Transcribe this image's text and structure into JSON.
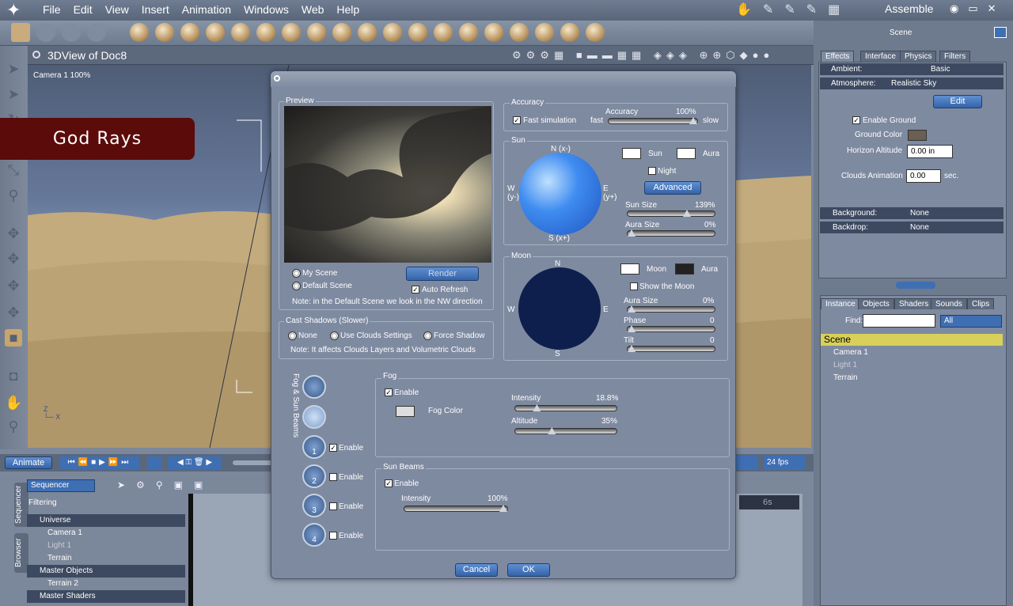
{
  "menu": [
    "File",
    "Edit",
    "View",
    "Insert",
    "Animation",
    "Windows",
    "Web",
    "Help"
  ],
  "topright": {
    "room": "Assemble"
  },
  "view": {
    "title": "3DView of Doc8",
    "camera": "Camera 1 100%",
    "banner": "God Rays"
  },
  "timeline": {
    "animate": "Animate",
    "fps": "24 fps",
    "sequencer": "Sequencer",
    "filtering": "Filtering",
    "time_label": "6s",
    "tabs": [
      "Sequencer",
      "Browser"
    ],
    "rows": [
      "Universe",
      "Camera 1",
      "Light 1",
      "Terrain",
      "Master Objects",
      "Terrain 2",
      "Master Shaders"
    ]
  },
  "panel": {
    "title": "Scene",
    "tabs": [
      "Effects",
      "Interface",
      "Physics",
      "Filters"
    ],
    "ambient_label": "Ambient:",
    "ambient_value": "Basic",
    "atmosphere_label": "Atmosphere:",
    "atmosphere_value": "Realistic Sky",
    "edit": "Edit",
    "enable_ground": "Enable Ground",
    "ground_color": "Ground Color",
    "horizon_altitude": "Horizon Altitude",
    "horizon_value": "0.00 in",
    "clouds_animation": "Clouds Animation",
    "clouds_value": "0.00",
    "clouds_unit": "sec.",
    "background_label": "Background:",
    "background_value": "None",
    "backdrop_label": "Backdrop:",
    "backdrop_value": "None",
    "tabs2": [
      "Instance",
      "Objects",
      "Shaders",
      "Sounds",
      "Clips"
    ],
    "find_label": "Find:",
    "find_value": "",
    "filter": "All",
    "tree": [
      "Scene",
      "Camera 1",
      "Light 1",
      "Terrain"
    ]
  },
  "dialog": {
    "preview": "Preview",
    "my_scene": "My Scene",
    "default_scene": "Default Scene",
    "render": "Render",
    "auto_refresh": "Auto Refresh",
    "note1": "Note: in the Default Scene we look in the NW direction",
    "cast_shadows": "Cast Shadows (Slower)",
    "none": "None",
    "use_clouds": "Use Clouds Settings",
    "force_shadow": "Force Shadow",
    "note2": "Note: It affects Clouds Layers and Volumetric Clouds",
    "accuracy_group": "Accuracy",
    "fast_sim": "Fast simulation",
    "fast": "fast",
    "slow": "slow",
    "accuracy_label": "Accuracy",
    "accuracy_value": "100%",
    "accuracy_level": 1.0,
    "sun_group": "Sun",
    "sun_n": "N (x-)",
    "sun_s": "S (x+)",
    "sun_w": "W\n(y-)",
    "sun_e": "E\n(y+)",
    "sun": "Sun",
    "aura": "Aura",
    "night": "Night",
    "advanced": "Advanced",
    "sun_size": "Sun Size",
    "sun_size_value": "139%",
    "sun_size_level": 0.7,
    "aura_size": "Aura Size",
    "aura_size_value": "0%",
    "aura_size_level": 0.0,
    "moon_group": "Moon",
    "moon_n": "N",
    "moon_s": "S",
    "moon_w": "W",
    "moon_e": "E",
    "moon": "Moon",
    "moon_aura": "Aura",
    "show_moon": "Show the Moon",
    "moon_aura_size": "Aura Size",
    "moon_aura_value": "0%",
    "moon_aura_level": 0.0,
    "phase": "Phase",
    "phase_value": "0",
    "phase_level": 0.0,
    "tilt": "Tilt",
    "tilt_value": "0",
    "tilt_level": 0.0,
    "side_label": "Fog & Sun Beams",
    "fog_group": "Fog",
    "fog_enable": "Enable",
    "fog_color": "Fog Color",
    "intensity": "Intensity",
    "intensity_value": "18.8%",
    "intensity_level": 0.19,
    "altitude": "Altitude",
    "altitude_value": "35%",
    "altitude_level": 0.35,
    "beams_group": "Sun Beams",
    "beams_enable": "Enable",
    "beam_intensity": "Intensity",
    "beam_intensity_value": "100%",
    "beam_intensity_level": 1.0,
    "enable": "Enable",
    "cancel": "Cancel",
    "ok": "OK"
  },
  "colors": {
    "accent": "#3563a8",
    "banner": "#5c0b0b",
    "sun_orb": "#3f8cf0",
    "moon_orb": "#0f1f4d"
  }
}
